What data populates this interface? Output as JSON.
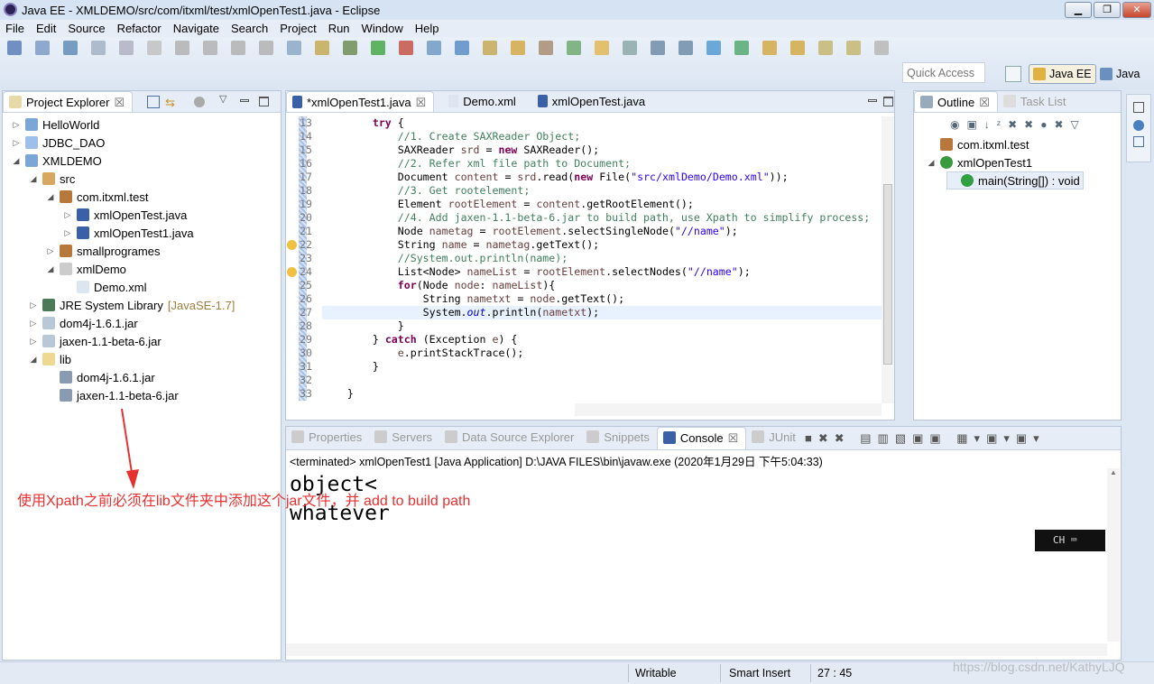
{
  "window": {
    "title": "Java EE - XMLDEMO/src/com/itxml/test/xmlOpenTest1.java - Eclipse",
    "min": "▁",
    "max": "❐",
    "close": "✕"
  },
  "menu": [
    "File",
    "Edit",
    "Source",
    "Refactor",
    "Navigate",
    "Search",
    "Project",
    "Run",
    "Window",
    "Help"
  ],
  "toolbar": {
    "quick_access": "Quick Access",
    "perspectives": [
      "Java EE",
      "Java"
    ]
  },
  "explorer": {
    "tab": "Project Explorer",
    "close": "☒",
    "items": [
      {
        "label": "HelloWorld",
        "depth": 0,
        "arrow": "▷",
        "icon": "project-icon"
      },
      {
        "label": "JDBC_DAO",
        "depth": 0,
        "arrow": "▷",
        "icon": "folder-icon"
      },
      {
        "label": "XMLDEMO",
        "depth": 0,
        "arrow": "◢",
        "icon": "project-icon"
      },
      {
        "label": "src",
        "depth": 1,
        "arrow": "◢",
        "icon": "source-folder-icon"
      },
      {
        "label": "com.itxml.test",
        "depth": 2,
        "arrow": "◢",
        "icon": "package-icon"
      },
      {
        "label": "xmlOpenTest.java",
        "depth": 3,
        "arrow": "▷",
        "icon": "java-file-icon"
      },
      {
        "label": "xmlOpenTest1.java",
        "depth": 3,
        "arrow": "▷",
        "icon": "java-file-icon"
      },
      {
        "label": "smallprogrames",
        "depth": 2,
        "arrow": "▷",
        "icon": "package-icon"
      },
      {
        "label": "xmlDemo",
        "depth": 2,
        "arrow": "◢",
        "icon": "empty-package-icon"
      },
      {
        "label": "Demo.xml",
        "depth": 3,
        "arrow": "",
        "icon": "xml-file-icon"
      },
      {
        "label": "JRE System Library",
        "suffix": "[JavaSE-1.7]",
        "depth": 1,
        "arrow": "▷",
        "icon": "library-icon"
      },
      {
        "label": "dom4j-1.6.1.jar",
        "depth": 1,
        "arrow": "▷",
        "icon": "jar-icon"
      },
      {
        "label": "jaxen-1.1-beta-6.jar",
        "depth": 1,
        "arrow": "▷",
        "icon": "jar-icon"
      },
      {
        "label": "lib",
        "depth": 1,
        "arrow": "◢",
        "icon": "open-folder-icon"
      },
      {
        "label": "dom4j-1.6.1.jar",
        "depth": 2,
        "arrow": "",
        "icon": "jar-file-icon"
      },
      {
        "label": "jaxen-1.1-beta-6.jar",
        "depth": 2,
        "arrow": "",
        "icon": "jar-file-icon"
      }
    ]
  },
  "editor": {
    "tabs": [
      {
        "label": "*xmlOpenTest1.java",
        "active": true
      },
      {
        "label": "Demo.xml"
      },
      {
        "label": "xmlOpenTest.java"
      }
    ],
    "current_line": 27,
    "lines": [
      {
        "n": "13",
        "t": [
          [
            "p",
            "        "
          ],
          [
            "kw",
            "try"
          ],
          [
            "p",
            " {"
          ]
        ]
      },
      {
        "n": "14",
        "t": [
          [
            "p",
            "            "
          ],
          [
            "cm",
            "//1. Create SAXReader Object;"
          ]
        ]
      },
      {
        "n": "15",
        "t": [
          [
            "p",
            "            SAXReader "
          ],
          [
            "var",
            "srd"
          ],
          [
            "p",
            " = "
          ],
          [
            "kw",
            "new"
          ],
          [
            "p",
            " SAXReader();"
          ]
        ]
      },
      {
        "n": "16",
        "t": [
          [
            "p",
            "            "
          ],
          [
            "cm",
            "//2. Refer xml file path to Document;"
          ]
        ]
      },
      {
        "n": "17",
        "t": [
          [
            "p",
            "            Document "
          ],
          [
            "var",
            "content"
          ],
          [
            "p",
            " = "
          ],
          [
            "var",
            "srd"
          ],
          [
            "p",
            ".read("
          ],
          [
            "kw",
            "new"
          ],
          [
            "p",
            " File("
          ],
          [
            "str",
            "\"src/xmlDemo/Demo.xml\""
          ],
          [
            "p",
            "));"
          ]
        ]
      },
      {
        "n": "18",
        "t": [
          [
            "p",
            "            "
          ],
          [
            "cm",
            "//3. Get rootelement;"
          ]
        ]
      },
      {
        "n": "19",
        "t": [
          [
            "p",
            "            Element "
          ],
          [
            "var",
            "rootElement"
          ],
          [
            "p",
            " = "
          ],
          [
            "var",
            "content"
          ],
          [
            "p",
            ".getRootElement();"
          ]
        ]
      },
      {
        "n": "20",
        "t": [
          [
            "p",
            "            "
          ],
          [
            "cm",
            "//4. Add jaxen-1.1-beta-6.jar to build path, use Xpath to simplify process;"
          ]
        ]
      },
      {
        "n": "21",
        "t": [
          [
            "p",
            "            Node "
          ],
          [
            "var",
            "nametag"
          ],
          [
            "p",
            " = "
          ],
          [
            "var",
            "rootElement"
          ],
          [
            "p",
            ".selectSingleNode("
          ],
          [
            "str",
            "\"//name\""
          ],
          [
            "p",
            ");"
          ]
        ]
      },
      {
        "n": "22",
        "t": [
          [
            "p",
            "            String "
          ],
          [
            "var",
            "name"
          ],
          [
            "p",
            " = "
          ],
          [
            "var",
            "nametag"
          ],
          [
            "p",
            ".getText();"
          ]
        ],
        "warn": true
      },
      {
        "n": "23",
        "t": [
          [
            "p",
            "            "
          ],
          [
            "cm",
            "//System.out.println(name);"
          ]
        ]
      },
      {
        "n": "24",
        "t": [
          [
            "p",
            "            List<Node> "
          ],
          [
            "var",
            "nameList"
          ],
          [
            "p",
            " = "
          ],
          [
            "var",
            "rootElement"
          ],
          [
            "p",
            ".selectNodes("
          ],
          [
            "str",
            "\"//name\""
          ],
          [
            "p",
            ");"
          ]
        ],
        "warn": true
      },
      {
        "n": "25",
        "t": [
          [
            "p",
            "            "
          ],
          [
            "kw",
            "for"
          ],
          [
            "p",
            "(Node "
          ],
          [
            "var",
            "node"
          ],
          [
            "p",
            ": "
          ],
          [
            "var",
            "nameList"
          ],
          [
            "p",
            "){"
          ]
        ]
      },
      {
        "n": "26",
        "t": [
          [
            "p",
            "                String "
          ],
          [
            "var",
            "nametxt"
          ],
          [
            "p",
            " = "
          ],
          [
            "var",
            "node"
          ],
          [
            "p",
            ".getText();"
          ]
        ]
      },
      {
        "n": "27",
        "t": [
          [
            "p",
            "                System."
          ],
          [
            "fld",
            "out"
          ],
          [
            "p",
            ".println("
          ],
          [
            "var",
            "nametxt"
          ],
          [
            "p",
            ");"
          ]
        ]
      },
      {
        "n": "28",
        "t": [
          [
            "p",
            "            }"
          ]
        ]
      },
      {
        "n": "29",
        "t": [
          [
            "p",
            "        } "
          ],
          [
            "kw",
            "catch"
          ],
          [
            "p",
            " (Exception "
          ],
          [
            "var",
            "e"
          ],
          [
            "p",
            ") {"
          ]
        ]
      },
      {
        "n": "30",
        "t": [
          [
            "p",
            "            "
          ],
          [
            "var",
            "e"
          ],
          [
            "p",
            ".printStackTrace();"
          ]
        ]
      },
      {
        "n": "31",
        "t": [
          [
            "p",
            "        }"
          ]
        ]
      },
      {
        "n": "32",
        "t": [
          [
            "p",
            ""
          ]
        ]
      },
      {
        "n": "33",
        "t": [
          [
            "p",
            "    }"
          ]
        ]
      }
    ]
  },
  "outline": {
    "tabs": [
      "Outline",
      "Task List"
    ],
    "items": [
      {
        "label": "com.itxml.test",
        "depth": 0,
        "icon": "package-icon"
      },
      {
        "label": "xmlOpenTest1",
        "depth": 0,
        "arrow": "◢",
        "icon": "class-icon"
      },
      {
        "label": "main(String[]) : void",
        "depth": 1,
        "icon": "method-icon",
        "selected": true
      }
    ]
  },
  "console": {
    "tabs": [
      "Properties",
      "Servers",
      "Data Source Explorer",
      "Snippets",
      "Console",
      "JUnit"
    ],
    "active_tab": "Console",
    "header": "<terminated> xmlOpenTest1 [Java Application] D:\\JAVA FILES\\bin\\javaw.exe (2020年1月29日 下午5:04:33)",
    "output": [
      "object<",
      "whatever"
    ]
  },
  "annotation": "使用Xpath之前必须在lib文件夹中添加这个jar文件，并 add to build path",
  "ime": "CH ⌨",
  "status": {
    "mode": "Writable",
    "insert": "Smart Insert",
    "position": "27 : 45"
  },
  "watermark": "https://blog.csdn.net/KathyLJQ",
  "colors": {
    "keyword": "#7f0055",
    "comment": "#3f7f5f",
    "string": "#2a00ff",
    "annotation": "#e83030"
  }
}
